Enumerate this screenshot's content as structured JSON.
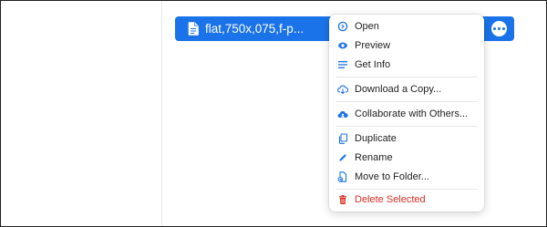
{
  "file": {
    "name": "flat,750x,075,f-p...",
    "type": "JPEG",
    "icon": "image-file-icon"
  },
  "menu": {
    "open": "Open",
    "preview": "Preview",
    "get_info": "Get Info",
    "download": "Download a Copy...",
    "collaborate": "Collaborate with Others...",
    "duplicate": "Duplicate",
    "rename": "Rename",
    "move": "Move to Folder...",
    "delete": "Delete Selected"
  },
  "colors": {
    "accent": "#1a73e8",
    "danger": "#d93025"
  }
}
